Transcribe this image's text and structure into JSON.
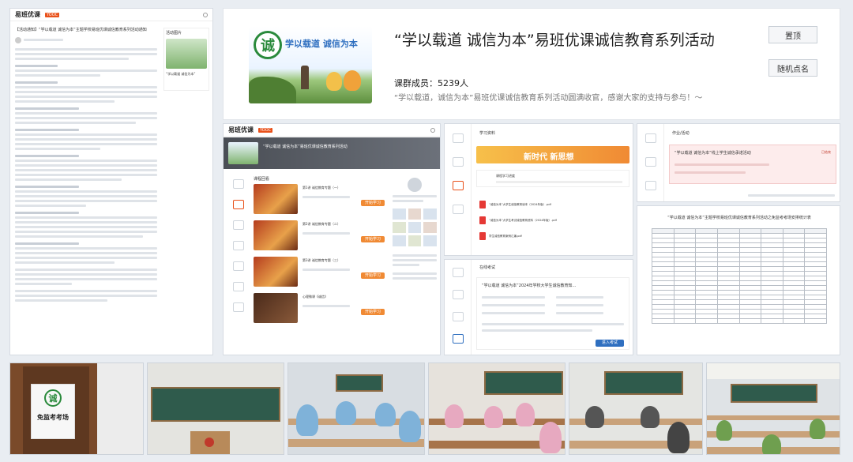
{
  "left_page": {
    "nav": {
      "brand": "易班优课",
      "brand_tag": "YOOC"
    },
    "article_title": "【活动通知】“学以载道 诚信为本”主题学校易班优课诚信教育系列活动通知",
    "side_label": "活动图片",
    "side_caption": "“学以载道 诚信为本”"
  },
  "hero": {
    "logo_char": "诚",
    "banner_text": "学以载道  诚信为本",
    "title": "“学以载道 诚信为本”易班优课诚信教育系列活动",
    "members_label": "课群成员：",
    "members_count": "5239人",
    "description": "“学以载道，诚信为本”易班优课诚信教育系列活动圆满收官，感谢大家的支持与参与！～",
    "btn_top": "置顶",
    "btn_random": "随机点名"
  },
  "course_page": {
    "nav": {
      "brand": "易班优课",
      "brand_tag": "YOOC"
    },
    "header_text": "“学以载道 诚信为本”易班优课诚信教育系列活动",
    "section_label": "课程回看",
    "items": [
      {
        "title": "第1讲 诚信教育专题（一）",
        "btn": "开始学习"
      },
      {
        "title": "第2讲 诚信教育专题（二）",
        "btn": "开始学习"
      },
      {
        "title": "第3讲 诚信教育专题（三）",
        "btn": "开始学习"
      },
      {
        "title": "心理微课《诚信》",
        "btn": "开始学习"
      }
    ]
  },
  "study_page": {
    "header": "学习资料",
    "banner_text": "新时代 新思想",
    "progress_label": "课程学习进度",
    "files": [
      "“诚信为本”大学生诚信教育读本（2024年版）.pdf",
      "“诚信为本”大学生考试诚信教育资料（2024年版）.pdf",
      "学生诚信教育案例汇编.pdf"
    ]
  },
  "exam_page": {
    "header": "在线考试",
    "title": "“学以载道 诚信为本”2024年学校大学生诚信教育知...",
    "btn": "进入考试"
  },
  "notice_page": {
    "header": "作业/活动",
    "title": "“学以载道 诚信为本”线上学生诚信承诺活动",
    "tag": "已结束"
  },
  "schedule": {
    "title": "“学以载道 诚信为本”主题学校易班优课诚信教育系列活动之免监考考场安排统计表"
  },
  "photos": {
    "sign_line1": "免监考考场",
    "sign_logo": "诚"
  },
  "colors": {
    "accent": "#e9511a",
    "orange": "#f08a34",
    "green": "#2a8a3c",
    "red": "#c0392b"
  }
}
